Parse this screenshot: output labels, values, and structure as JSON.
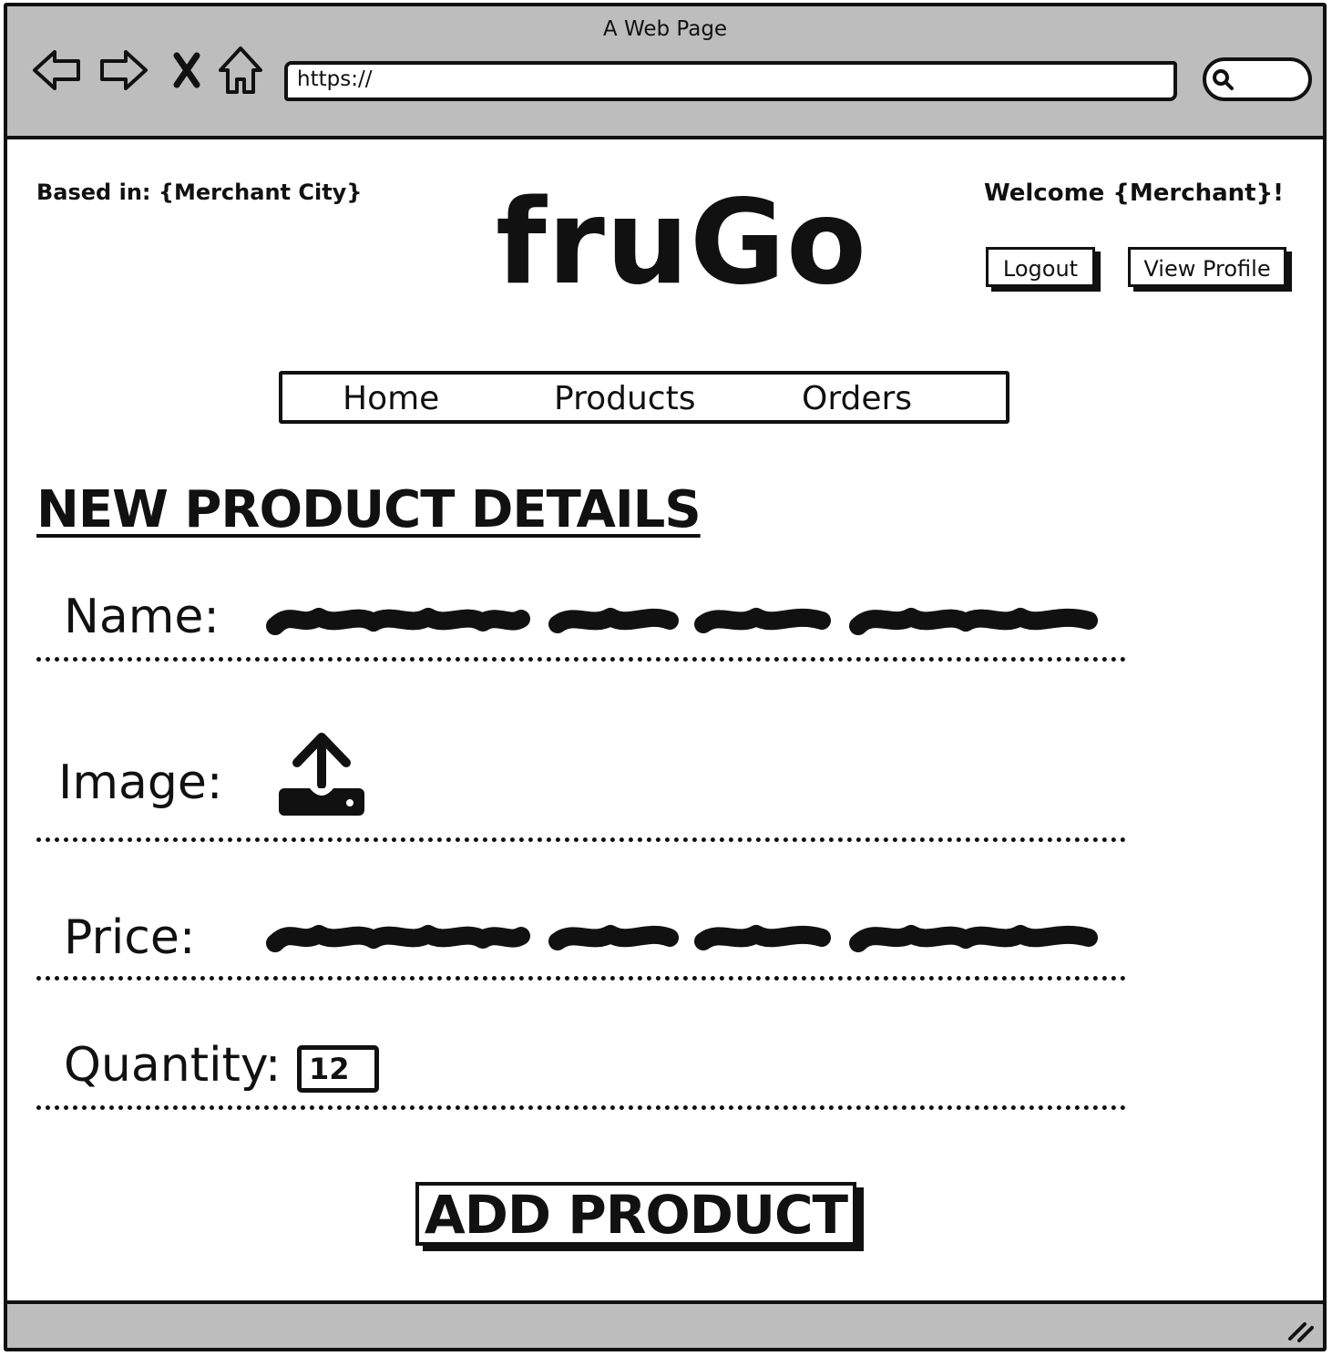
{
  "window": {
    "title": "A Web Page"
  },
  "browser": {
    "url": "https://",
    "back_icon": "arrow-left-icon",
    "forward_icon": "arrow-right-icon",
    "close_icon": "close-icon",
    "home_icon": "home-icon",
    "search_icon": "search-icon"
  },
  "header": {
    "based_in": "Based in: {Merchant City}",
    "logo": "fruGo",
    "welcome": "Welcome {Merchant}!",
    "logout_label": "Logout",
    "view_profile_label": "View Profile"
  },
  "nav": {
    "items": [
      {
        "label": "Home"
      },
      {
        "label": "Products"
      },
      {
        "label": "Orders"
      }
    ]
  },
  "form": {
    "heading": "NEW PRODUCT DETAILS",
    "name_label": "Name:",
    "image_label": "Image:",
    "image_icon": "upload-icon",
    "price_label": "Price:",
    "quantity_label": "Quantity:",
    "quantity_value": "12",
    "submit_label": "ADD PRODUCT"
  }
}
